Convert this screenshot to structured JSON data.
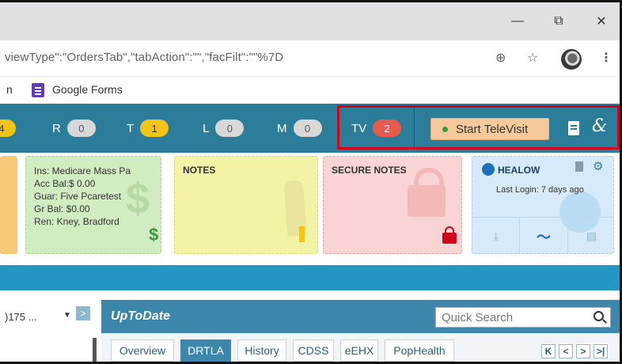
{
  "browser": {
    "controls": {
      "minimize": "—",
      "restore": "⧉",
      "close": "✕"
    },
    "url_fragment": "viewType\":\"OrdersTab\",\"tabAction\":\"\",\"facFilt\":\"\"%7D",
    "bookmarks": {
      "truncated": "n",
      "google_forms": "Google Forms"
    }
  },
  "header": {
    "chips": [
      {
        "letter": "",
        "count": "4",
        "color": "yellow"
      },
      {
        "letter": "R",
        "count": "0",
        "color": "grey"
      },
      {
        "letter": "T",
        "count": "1",
        "color": "yellow"
      },
      {
        "letter": "L",
        "count": "0",
        "color": "grey"
      },
      {
        "letter": "M",
        "count": "0",
        "color": "grey"
      },
      {
        "letter": "TV",
        "count": "2",
        "color": "red"
      }
    ],
    "televisit_label": "Start TeleVisit"
  },
  "cards": {
    "billing": {
      "lines": [
        "Ins: Medicare Mass Pa",
        "Acc Bal:$ 0.00",
        "Guar: Five Pcaretest",
        "Gr Bal: $0.00",
        "Ren: Kney, Bradford"
      ]
    },
    "notes": {
      "title": "NOTES"
    },
    "secure_notes": {
      "title": "SECURE NOTES"
    },
    "healow": {
      "title": "HEALOW",
      "last_login": "Last Login: 7 days ago"
    }
  },
  "bottom": {
    "filter_value": ")175 ...",
    "uptodate": {
      "title": "UpToDate",
      "search_placeholder": "Quick Search",
      "tabs": [
        "Overview",
        "DRTLA",
        "History",
        "CDSS",
        "eEHX",
        "PopHealth"
      ],
      "active_tab": "DRTLA"
    }
  }
}
